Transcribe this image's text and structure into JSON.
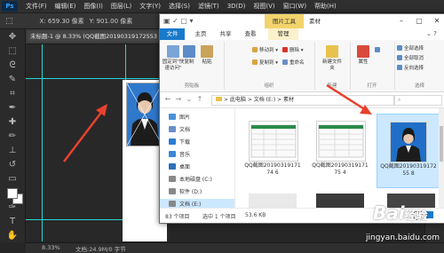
{
  "ps": {
    "logo": "Ps",
    "menu": [
      "文件(F)",
      "编辑(E)",
      "图像(I)",
      "图层(L)",
      "文字(Y)",
      "选择(S)",
      "滤镜(T)",
      "3D(D)",
      "视图(V)",
      "窗口(W)",
      "帮助(H)"
    ],
    "options": {
      "x": "X: 659.30 像素",
      "y": "Y: 901.00 像素"
    },
    "doc_tab": "未标题-1 @ 8.33% (QQ截图20190319172553",
    "status_zoom": "8.33%",
    "status_doc": "文档:24.9M/0 字节"
  },
  "explorer": {
    "context_tab": "图片工具",
    "title": "素材",
    "tabs": {
      "file": "文件",
      "home": "主页",
      "share": "共享",
      "view": "查看",
      "manage": "管理"
    },
    "ribbon": {
      "pin": "固定到\"快速访问\"",
      "copy": "复制",
      "paste": "粘贴",
      "clipboard": "剪贴板",
      "move_to": "移动到",
      "copy_to": "复制到",
      "delete": "删除",
      "rename": "重命名",
      "organize": "组织",
      "new_folder": "新建文件夹",
      "new": "新建",
      "properties": "属性",
      "open": "打开",
      "select_all": "全部选择",
      "select_none": "全部取消",
      "invert": "反向选择",
      "select": "选择"
    },
    "address": "> 此电脑 > 文档 (E:) > 素材",
    "nav": [
      {
        "label": "图片",
        "color": "#4a90d9"
      },
      {
        "label": "文档",
        "color": "#6a8fc7"
      },
      {
        "label": "下载",
        "color": "#2b7bd1"
      },
      {
        "label": "音乐",
        "color": "#3a87d8"
      },
      {
        "label": "桌面",
        "color": "#2e6fb8"
      },
      {
        "label": "本地磁盘 (C:)",
        "color": "#888"
      },
      {
        "label": "软件 (D:)",
        "color": "#888"
      },
      {
        "label": "文档 (E:)",
        "color": "#888"
      }
    ],
    "files": [
      {
        "name": "QQ截图2019031917174 6"
      },
      {
        "name": "QQ截图2019031917175 4"
      },
      {
        "name": "QQ截图2019031917255 8"
      }
    ],
    "status": {
      "count": "83 个项目",
      "selected": "选中 1 个项目",
      "size": "53.6 KB"
    }
  },
  "watermark": {
    "brand": "Bai",
    "brand2": "经验",
    "url": "jingyan.baidu.com"
  },
  "colors": {
    "annotation_arrow": "#e8412e",
    "guide": "#29d6d6",
    "ribbon_file_tab": "#1979ca",
    "context_tab": "#f3d36b"
  }
}
